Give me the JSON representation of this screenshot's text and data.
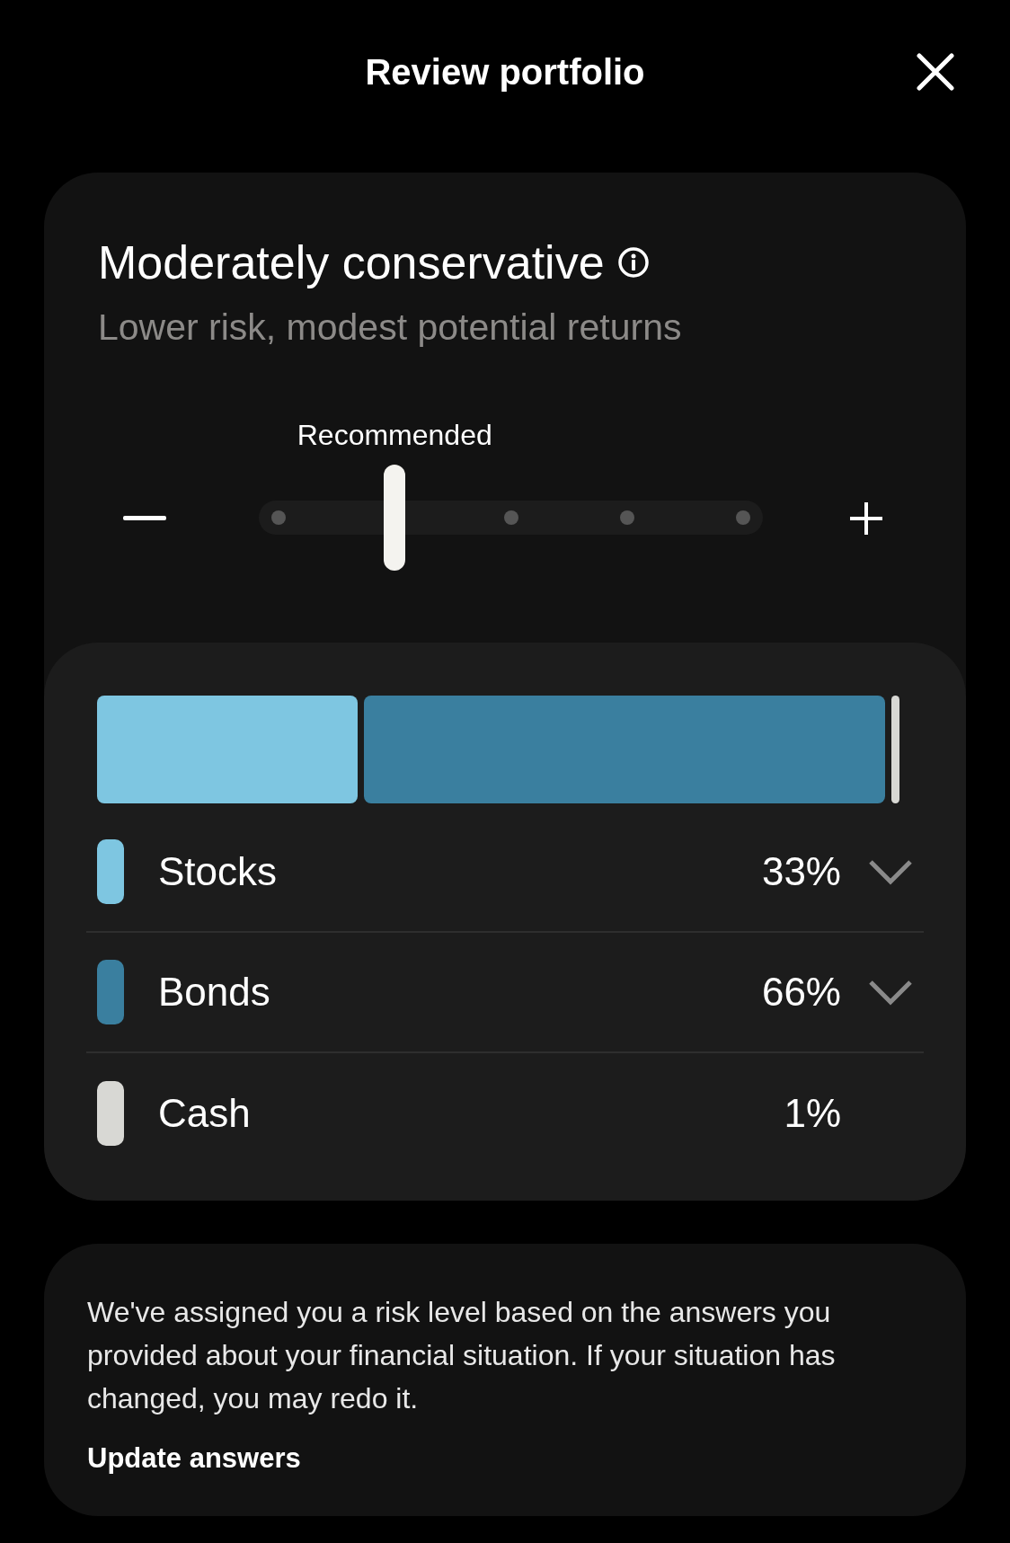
{
  "header": {
    "title": "Review portfolio"
  },
  "risk": {
    "name": "Moderately conservative",
    "description": "Lower risk, modest potential returns",
    "slider": {
      "label": "Recommended",
      "level": 0.25
    }
  },
  "allocations": [
    {
      "name": "Stocks",
      "percent": "33%",
      "color": "#7ec6e1",
      "kind": "expandable"
    },
    {
      "name": "Bonds",
      "percent": "66%",
      "color": "#3a7f9f",
      "kind": "expandable"
    },
    {
      "name": "Cash",
      "percent": "1%",
      "color": "#d8d8d4",
      "kind": "plain"
    }
  ],
  "info": {
    "text": "We've assigned you a risk level based on the answers you provided about your financial situation. If your situation has changed, you may redo it.",
    "link": "Update answers"
  }
}
